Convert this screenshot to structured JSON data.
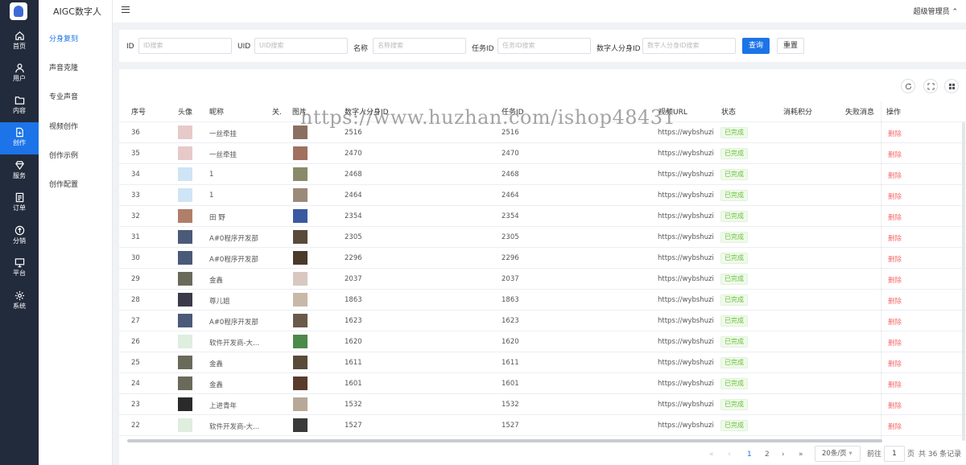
{
  "nav_rail": [
    {
      "label": "首页",
      "icon": "home-icon"
    },
    {
      "label": "用户",
      "icon": "user-icon"
    },
    {
      "label": "内容",
      "icon": "folder-icon"
    },
    {
      "label": "创作",
      "icon": "document-add-icon",
      "active": true
    },
    {
      "label": "服务",
      "icon": "diamond-icon"
    },
    {
      "label": "订单",
      "icon": "order-list-icon"
    },
    {
      "label": "分销",
      "icon": "share-icon"
    },
    {
      "label": "平台",
      "icon": "monitor-icon"
    },
    {
      "label": "系统",
      "icon": "settings-icon"
    }
  ],
  "sub_menu": {
    "brand": "AIGC数字人",
    "items": [
      {
        "label": "分身复刻",
        "active": true
      },
      {
        "label": "声音克隆"
      },
      {
        "label": "专业声音"
      },
      {
        "label": "视频创作"
      },
      {
        "label": "创作示例"
      },
      {
        "label": "创作配置"
      }
    ]
  },
  "header": {
    "user": "超级管理员"
  },
  "filters": {
    "id": {
      "label": "ID",
      "placeholder": "ID搜索"
    },
    "uid": {
      "label": "UID",
      "placeholder": "UID搜索"
    },
    "name": {
      "label": "名称",
      "placeholder": "名称搜索"
    },
    "task_id": {
      "label": "任务ID",
      "placeholder": "任务ID搜索"
    },
    "avatar_id": {
      "label": "数字人分身ID",
      "placeholder": "数字人分身ID搜索"
    },
    "search_button": "查询",
    "reset_button": "重置"
  },
  "table": {
    "headers": {
      "seq": "序号",
      "avatar": "头像",
      "nickname": "昵称",
      "related": "关.",
      "image": "图片",
      "avatar_id": "数字人分身ID",
      "task_id": "任务ID",
      "video_url": "视频URL",
      "status": "状态",
      "points": "消耗积分",
      "fail_msg": "失败消息",
      "actions": "操作"
    },
    "rows": [
      {
        "seq": "36",
        "nickname": "一丝牵挂",
        "avatar_id": "2516",
        "task_id": "2516",
        "video_url": "https://wybshuzire",
        "status": "已完成",
        "action": "删除",
        "avatar_color": "#e8c9c9",
        "pic_color": "#8a7060"
      },
      {
        "seq": "35",
        "nickname": "一丝牵挂",
        "avatar_id": "2470",
        "task_id": "2470",
        "video_url": "https://wybshuzire",
        "status": "已完成",
        "action": "删除",
        "avatar_color": "#e8c9c9",
        "pic_color": "#a07060"
      },
      {
        "seq": "34",
        "nickname": "1",
        "avatar_id": "2468",
        "task_id": "2468",
        "video_url": "https://wybshuzire",
        "status": "已完成",
        "action": "删除",
        "avatar_color": "#cfe4f5",
        "pic_color": "#8a8a6a"
      },
      {
        "seq": "33",
        "nickname": "1",
        "avatar_id": "2464",
        "task_id": "2464",
        "video_url": "https://wybshuzire",
        "status": "已完成",
        "action": "删除",
        "avatar_color": "#cfe4f5",
        "pic_color": "#9a8a7a"
      },
      {
        "seq": "32",
        "nickname": "田 野",
        "avatar_id": "2354",
        "task_id": "2354",
        "video_url": "https://wybshuzire",
        "status": "已完成",
        "action": "删除",
        "avatar_color": "#b07f6a",
        "pic_color": "#3a5aa0"
      },
      {
        "seq": "31",
        "nickname": "A#0程序开发部",
        "avatar_id": "2305",
        "task_id": "2305",
        "video_url": "https://wybshuzire",
        "status": "已完成",
        "action": "删除",
        "avatar_color": "#4a5a78",
        "pic_color": "#5a4a3a"
      },
      {
        "seq": "30",
        "nickname": "A#0程序开发部",
        "avatar_id": "2296",
        "task_id": "2296",
        "video_url": "https://wybshuzire",
        "status": "已完成",
        "action": "删除",
        "avatar_color": "#4a5a78",
        "pic_color": "#4a3a2a"
      },
      {
        "seq": "29",
        "nickname": "金鑫",
        "avatar_id": "2037",
        "task_id": "2037",
        "video_url": "https://wybshuzire",
        "status": "已完成",
        "action": "删除",
        "avatar_color": "#6a6a5a",
        "pic_color": "#d8c8c0"
      },
      {
        "seq": "28",
        "nickname": "尊儿姐",
        "avatar_id": "1863",
        "task_id": "1863",
        "video_url": "https://wybshuzire",
        "status": "已完成",
        "action": "删除",
        "avatar_color": "#3a3a4a",
        "pic_color": "#c8b8a8"
      },
      {
        "seq": "27",
        "nickname": "A#0程序开发部",
        "avatar_id": "1623",
        "task_id": "1623",
        "video_url": "https://wybshuzire",
        "status": "已完成",
        "action": "删除",
        "avatar_color": "#4a5a78",
        "pic_color": "#6a5a4a"
      },
      {
        "seq": "26",
        "nickname": "软件开发商-大...",
        "avatar_id": "1620",
        "task_id": "1620",
        "video_url": "https://wybshuzire",
        "status": "已完成",
        "action": "删除",
        "avatar_color": "#dfeede",
        "pic_color": "#4a8a4a"
      },
      {
        "seq": "25",
        "nickname": "金鑫",
        "avatar_id": "1611",
        "task_id": "1611",
        "video_url": "https://wybshuzire",
        "status": "已完成",
        "action": "删除",
        "avatar_color": "#6a6a5a",
        "pic_color": "#5a4a3a"
      },
      {
        "seq": "24",
        "nickname": "金鑫",
        "avatar_id": "1601",
        "task_id": "1601",
        "video_url": "https://wybshuzire",
        "status": "已完成",
        "action": "删除",
        "avatar_color": "#6a6a5a",
        "pic_color": "#5a3a2a"
      },
      {
        "seq": "23",
        "nickname": "上进青年",
        "avatar_id": "1532",
        "task_id": "1532",
        "video_url": "https://wybshuzire",
        "status": "已完成",
        "action": "删除",
        "avatar_color": "#2a2a2a",
        "pic_color": "#b8a898"
      },
      {
        "seq": "22",
        "nickname": "软件开发商-大...",
        "avatar_id": "1527",
        "task_id": "1527",
        "video_url": "https://wybshuzire",
        "status": "已完成",
        "action": "删除",
        "avatar_color": "#dfeede",
        "pic_color": "#3a3a3a"
      }
    ]
  },
  "pagination": {
    "pages": [
      "1",
      "2"
    ],
    "current": "1",
    "page_size": "20条/页",
    "goto_label": "前往",
    "goto_value": "1",
    "page_unit": "页",
    "total": "共 36 条记录"
  },
  "watermark": "https://www.huzhan.com/ishop48431"
}
